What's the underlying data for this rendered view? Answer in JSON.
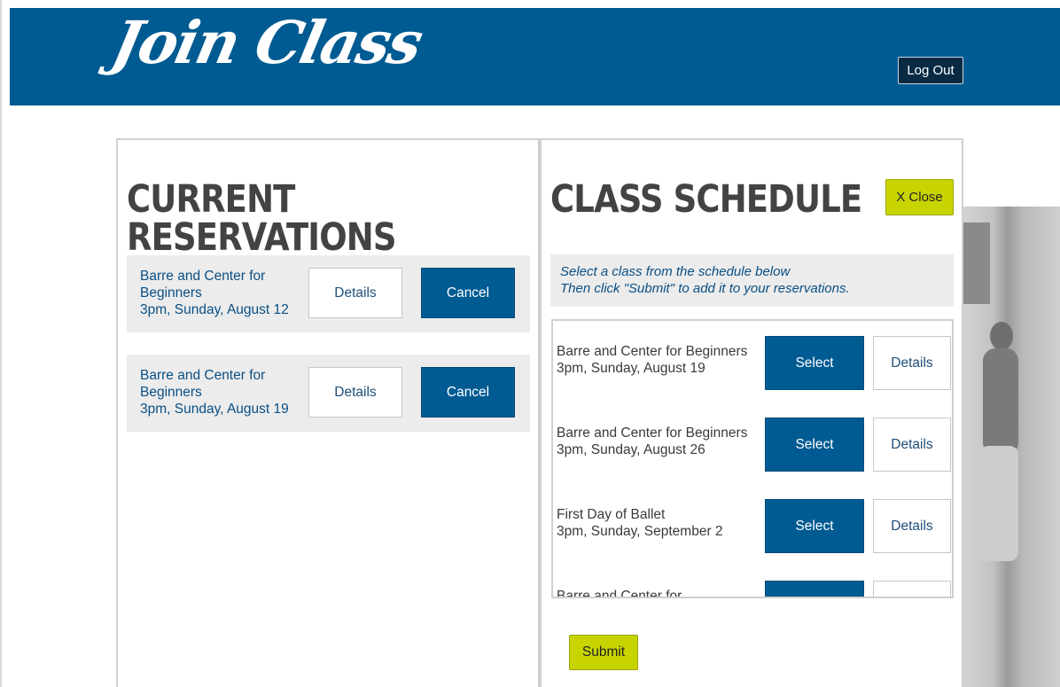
{
  "header": {
    "logo_text": "Join Class",
    "logout_label": "Log Out"
  },
  "reservations": {
    "title": "CURRENT RESERVATIONS",
    "items": [
      {
        "name": "Barre and Center for Beginners",
        "time": "3pm, Sunday, August 12",
        "details_label": "Details",
        "cancel_label": "Cancel"
      },
      {
        "name": "Barre and Center for Beginners",
        "time": "3pm, Sunday, August 19",
        "details_label": "Details",
        "cancel_label": "Cancel"
      }
    ]
  },
  "schedule": {
    "title": "CLASS SCHEDULE",
    "close_label": "X Close",
    "instruction_line1": "Select a class from the schedule below",
    "instruction_line2": "Then click \"Submit\" to add it to your reservations.",
    "items": [
      {
        "name": "Barre and Center for Beginners",
        "time": "3pm, Sunday, August 19",
        "select_label": "Select",
        "details_label": "Details"
      },
      {
        "name": "Barre and Center for Beginners",
        "time": "3pm, Sunday, August 26",
        "select_label": "Select",
        "details_label": "Details"
      },
      {
        "name": "First Day of Ballet",
        "time": "3pm, Sunday, September 2",
        "select_label": "Select",
        "details_label": "Details"
      },
      {
        "name": "Barre and Center for",
        "time": "",
        "select_label": "",
        "details_label": ""
      }
    ],
    "submit_label": "Submit"
  },
  "colors": {
    "brand_blue": "#005b92",
    "accent_lime": "#c8d400",
    "panel_gray": "#ececec"
  }
}
